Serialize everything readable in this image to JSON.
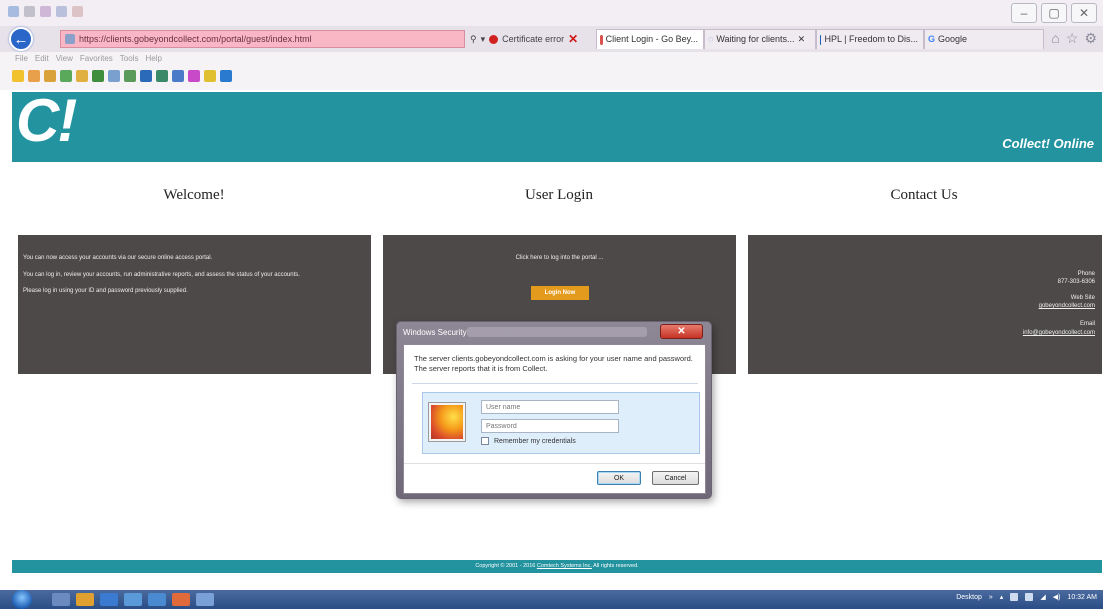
{
  "browser": {
    "address": "https://clients.gobeyondcollect.com/portal/guest/index.html",
    "certificate_error": "Certificate error",
    "tabs": [
      {
        "label": "Client Login - Go Bey...",
        "fav_color": "#d9534f"
      },
      {
        "label": "Waiting for clients...",
        "fav_color": "#5a8ed0"
      },
      {
        "label": "HPL | Freedom to Dis...",
        "fav_color": "#2060b0"
      },
      {
        "label": "Google",
        "fav_color": "#4285f4"
      }
    ],
    "menu": [
      "File",
      "Edit",
      "View",
      "Favorites",
      "Tools",
      "Help"
    ]
  },
  "site": {
    "logo": "C!",
    "brand": "Collect! Online",
    "columns": {
      "welcome": {
        "title": "Welcome!",
        "lines": [
          "You can now access your accounts via our secure online access portal.",
          "You can log in, review your accounts, run administrative reports, and assess the status of your accounts.",
          "Please log in using your ID and password previously supplied."
        ]
      },
      "login": {
        "title": "User Login",
        "prompt": "Click here to log into the portal ...",
        "button": "Login Now"
      },
      "contact": {
        "title": "Contact Us",
        "phone_label": "Phone",
        "phone": "877-303-6306",
        "web_label": "Web Site",
        "web": "gobeyondcollect.com",
        "email_label": "Email",
        "email": "info@gobeyondcollect.com"
      }
    },
    "footer": {
      "prefix": "Copyright © 2001 - 2016",
      "company": "Comtech Systems Inc.",
      "suffix": "All rights reserved."
    }
  },
  "dialog": {
    "title": "Windows Security",
    "message": "The server clients.gobeyondcollect.com is asking for your user name and password. The server reports that it is from Collect.",
    "username_placeholder": "User name",
    "password_placeholder": "Password",
    "remember_label": "Remember my credentials",
    "ok_label": "OK",
    "cancel_label": "Cancel"
  },
  "taskbar": {
    "desktop_label": "Desktop",
    "time": "10:32 AM"
  }
}
